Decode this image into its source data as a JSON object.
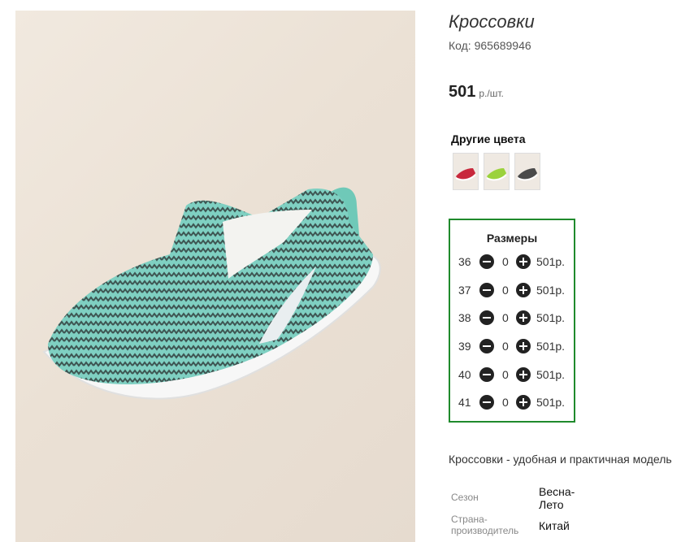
{
  "product": {
    "title": "Кроссовки",
    "code": "Код: 965689946",
    "price": "501",
    "price_unit": "р./шт.",
    "image_icon": "sneaker-photo"
  },
  "other_colors": {
    "title": "Другие цвета",
    "swatches": [
      {
        "name": "red",
        "color": "#c8283c"
      },
      {
        "name": "green",
        "color": "#9bd23c"
      },
      {
        "name": "dark",
        "color": "#4a4a4a"
      }
    ]
  },
  "sizes": {
    "title": "Размеры",
    "rows": [
      {
        "size": "36",
        "qty": "0",
        "price": "501р."
      },
      {
        "size": "37",
        "qty": "0",
        "price": "501р."
      },
      {
        "size": "38",
        "qty": "0",
        "price": "501р."
      },
      {
        "size": "39",
        "qty": "0",
        "price": "501р."
      },
      {
        "size": "40",
        "qty": "0",
        "price": "501р."
      },
      {
        "size": "41",
        "qty": "0",
        "price": "501р."
      }
    ],
    "border_color": "#1f8a2c"
  },
  "description": "Кроссовки - удобная и практичная модель",
  "specs": [
    {
      "label": "Сезон",
      "value": "Весна-Лето"
    },
    {
      "label": "Страна-производитель",
      "value": "Китай"
    }
  ]
}
